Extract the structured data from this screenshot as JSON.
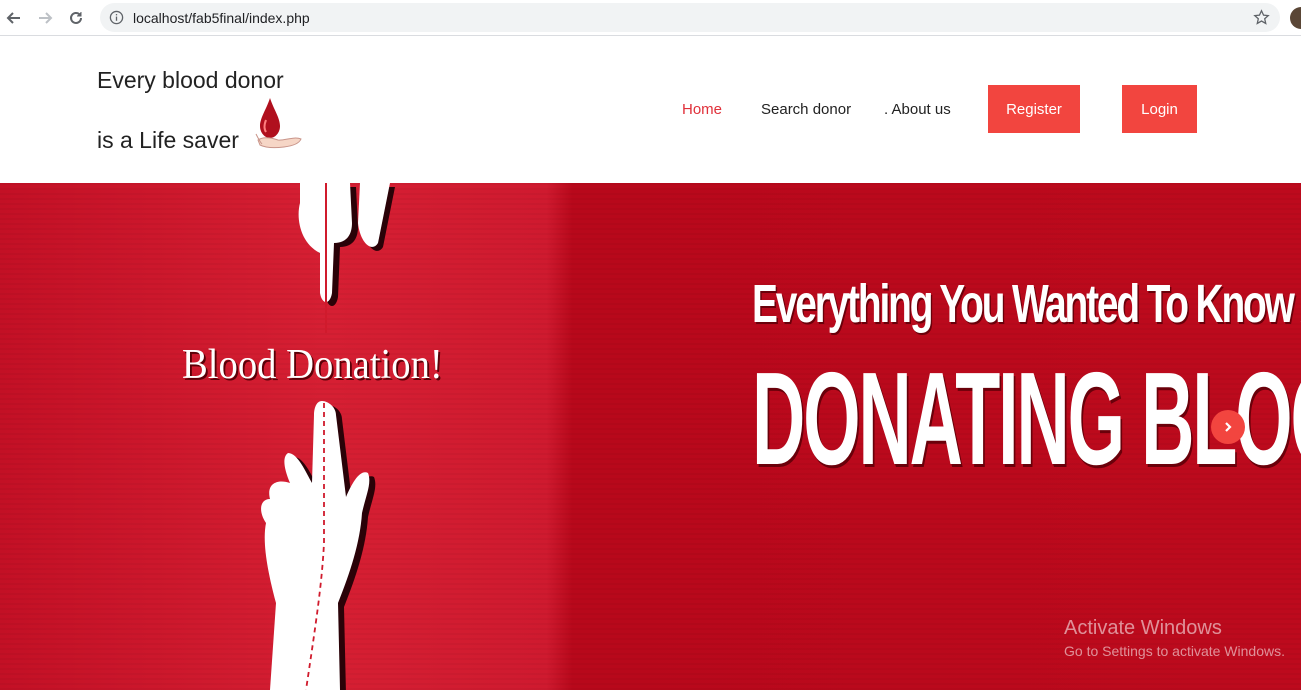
{
  "browser": {
    "url": "localhost/fab5final/index.php"
  },
  "header": {
    "tagline_line1": "Every blood donor",
    "tagline_line2": "is a Life saver",
    "nav": {
      "home": "Home",
      "search_donor": "Search donor",
      "about_us": ". About us"
    },
    "register_label": "Register",
    "login_label": "Login"
  },
  "hero": {
    "left_text": "Blood Donation!",
    "headline_small": "Everything You Wanted To Know About",
    "headline_big": "DONATING BLOOD"
  },
  "watermark": {
    "line1": "Activate Windows",
    "line2": "Go to Settings to activate Windows."
  },
  "colors": {
    "accent": "#f2453f",
    "active_link": "#e0303a",
    "hero_red": "#c31025"
  },
  "icons": {
    "back": "back-arrow-icon",
    "forward": "forward-arrow-icon",
    "reload": "reload-icon",
    "info": "info-icon",
    "bookmark": "star-icon",
    "next": "chevron-right-icon"
  }
}
